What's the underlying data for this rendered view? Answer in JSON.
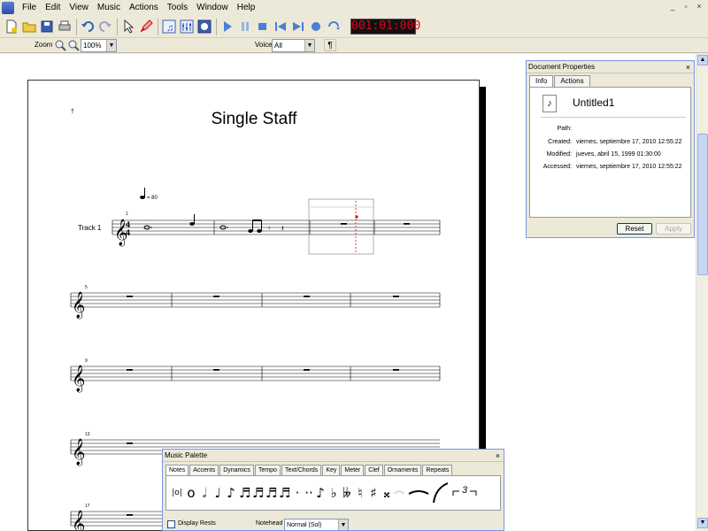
{
  "menu": {
    "items": [
      "File",
      "Edit",
      "View",
      "Music",
      "Actions",
      "Tools",
      "Window",
      "Help"
    ]
  },
  "window_controls": [
    "_",
    "▫",
    "×"
  ],
  "toolbar": {
    "buttons": [
      "new-document-icon",
      "open-folder-icon",
      "save-icon",
      "print-icon",
      "undo-icon",
      "redo-icon",
      "select-arrow-icon",
      "pencil-icon",
      "note-entry-icon",
      "mixer-icon",
      "info-icon",
      "play-icon",
      "pause-icon",
      "stop-icon",
      "rewind-icon",
      "fast-forward-icon",
      "record-icon",
      "loop-icon"
    ],
    "time_counter": "001:01:000"
  },
  "view_bar": {
    "zoom_label": "Zoom",
    "zoom_value": "100%",
    "voice_label": "Voice",
    "voice_value": "All",
    "formatting_symbol": "¶"
  },
  "score": {
    "title": "Single Staff",
    "corner_mark": "†",
    "tempo_equals": "= 80",
    "track_label": "Track 1",
    "time_signature_top": "4",
    "time_signature_bottom": "4",
    "measure_numbers": [
      "1",
      "5",
      "9",
      "13",
      "17"
    ]
  },
  "document_properties": {
    "title": "Document Properties",
    "tabs": [
      "Info",
      "Actions"
    ],
    "active_tab": "Info",
    "file_name": "Untitled1",
    "fields": [
      {
        "label": "Path:",
        "value": ""
      },
      {
        "label": "Created:",
        "value": "viernes, septiembre 17, 2010 12:55:22"
      },
      {
        "label": "Modified:",
        "value": "jueves, abril 15, 1999 01:30:00"
      },
      {
        "label": "Accessed:",
        "value": "viernes, septiembre 17, 2010 12:55:22"
      }
    ],
    "reset_label": "Reset",
    "apply_label": "Apply"
  },
  "music_palette": {
    "title": "Music Palette",
    "tabs": [
      "Notes",
      "Accents",
      "Dynamics",
      "Tempo",
      "Text/Chords",
      "Key",
      "Meter",
      "Clef",
      "Ornaments",
      "Repeats"
    ],
    "active_tab": "Notes",
    "symbols": [
      "|o|",
      "o",
      "𝅗𝅥",
      "♩",
      "♪",
      "♬",
      "♬",
      "♬",
      "♬",
      "·",
      "··",
      "♪",
      "♭",
      "𝄫",
      "♮",
      "♯",
      "𝄪"
    ],
    "tuplet_label": "3",
    "display_rests_label": "Display Rests",
    "notehead_label": "Notehead",
    "notehead_value": "Normal (Sol)"
  }
}
